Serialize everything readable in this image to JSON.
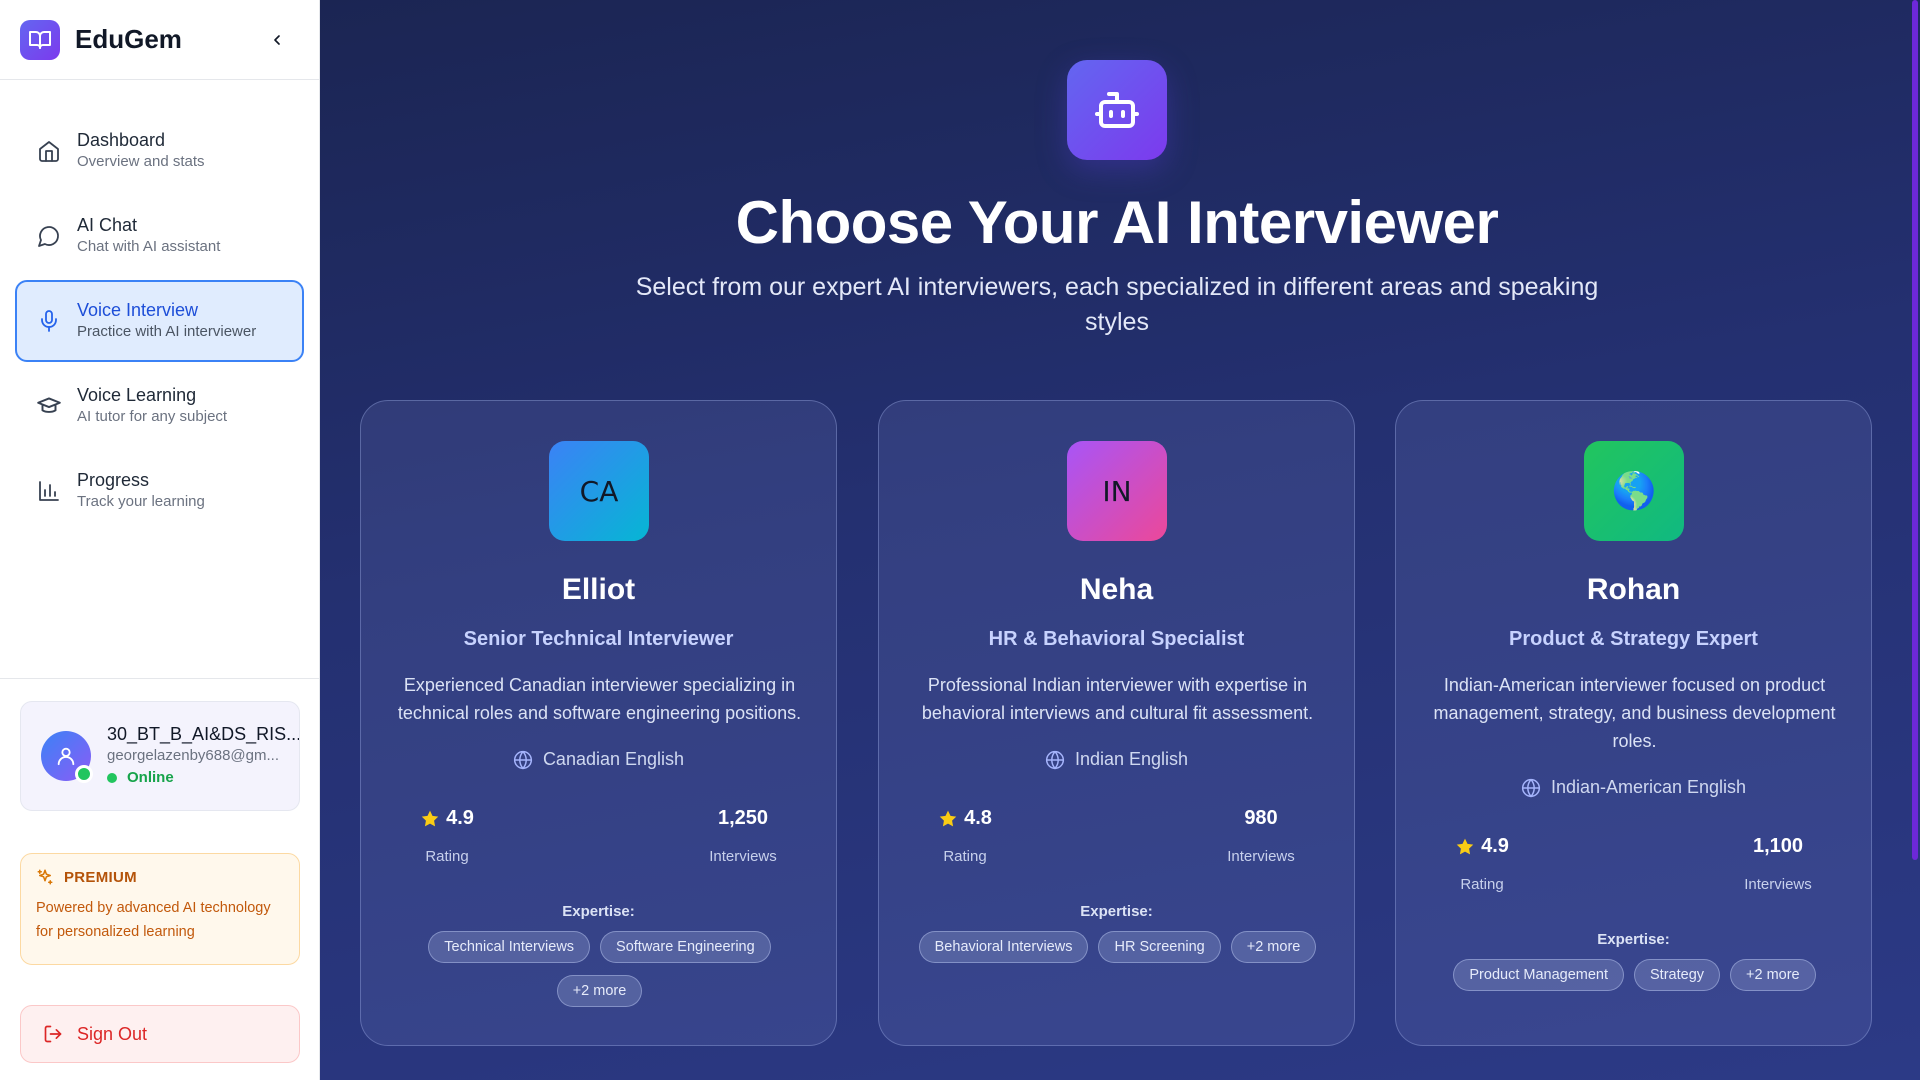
{
  "app": {
    "name": "EduGem"
  },
  "sidebar": {
    "items": [
      {
        "label": "Dashboard",
        "sub": "Overview and stats"
      },
      {
        "label": "AI Chat",
        "sub": "Chat with AI assistant"
      },
      {
        "label": "Voice Interview",
        "sub": "Practice with AI interviewer"
      },
      {
        "label": "Voice Learning",
        "sub": "AI tutor for any subject"
      },
      {
        "label": "Progress",
        "sub": "Track your learning"
      }
    ],
    "user": {
      "name": "30_BT_B_AI&DS_RIS...",
      "email": "georgelazenby688@gm...",
      "status": "Online"
    },
    "premium": {
      "title": "PREMIUM",
      "text": "Powered by advanced AI technology for personalized learning"
    },
    "signout": "Sign Out"
  },
  "main": {
    "title": "Choose Your AI Interviewer",
    "subtitle": "Select from our expert AI interviewers, each specialized in different areas and speaking styles",
    "cards": [
      {
        "initials": "CA",
        "name": "Elliot",
        "role": "Senior Technical Interviewer",
        "desc": "Experienced Canadian interviewer specializing in technical roles and software engineering positions.",
        "language": "Canadian English",
        "rating": "4.9",
        "rating_label": "Rating",
        "interviews": "1,250",
        "interviews_label": "Interviews",
        "expertise_label": "Expertise:",
        "tags": [
          "Technical Interviews",
          "Software Engineering",
          "+2 more"
        ]
      },
      {
        "initials": "IN",
        "name": "Neha",
        "role": "HR & Behavioral Specialist",
        "desc": "Professional Indian interviewer with expertise in behavioral interviews and cultural fit assessment.",
        "language": "Indian English",
        "rating": "4.8",
        "rating_label": "Rating",
        "interviews": "980",
        "interviews_label": "Interviews",
        "expertise_label": "Expertise:",
        "tags": [
          "Behavioral Interviews",
          "HR Screening",
          "+2 more"
        ]
      },
      {
        "initials": "🌎",
        "name": "Rohan",
        "role": "Product & Strategy Expert",
        "desc": "Indian-American interviewer focused on product management, strategy, and business development roles.",
        "language": "Indian-American English",
        "rating": "4.9",
        "rating_label": "Rating",
        "interviews": "1,100",
        "interviews_label": "Interviews",
        "expertise_label": "Expertise:",
        "tags": [
          "Product Management",
          "Strategy",
          "+2 more"
        ]
      }
    ]
  },
  "colors": {
    "accent": "#3b82f6",
    "brand": "#6366f1",
    "online": "#22c55e",
    "danger": "#dc2626"
  }
}
